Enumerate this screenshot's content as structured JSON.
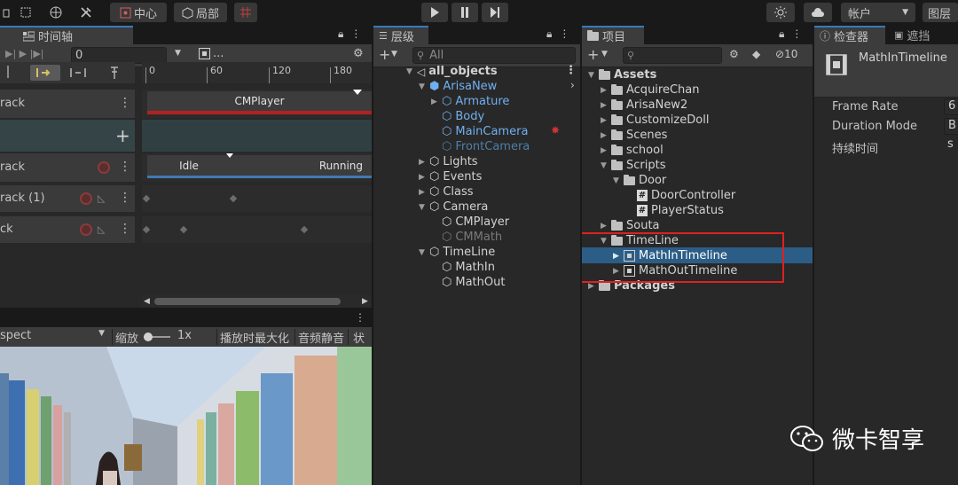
{
  "toolbar": {
    "pivot_label": "中心",
    "space_label": "局部",
    "account_label": "帐户",
    "layers_label": "图层"
  },
  "timeline": {
    "tab_label": "时间轴",
    "frame_value": "0",
    "asset_label": "...",
    "ruler_ticks": [
      "0",
      "60",
      "120",
      "180"
    ],
    "tracks": [
      {
        "label": "rack",
        "clips": [
          {
            "label": "CMPlayer"
          }
        ]
      },
      {
        "label": "rack",
        "clips": [
          {
            "label": "Idle"
          },
          {
            "label": "Running"
          }
        ]
      },
      {
        "label": "rack (1)"
      },
      {
        "label": "ck"
      }
    ]
  },
  "game_view": {
    "aspect_label": "spect",
    "scale_label": "缩放",
    "scale_value": "1x",
    "maximize_label": "播放时最大化",
    "mute_label": "音频静音",
    "stats_label": "状态"
  },
  "hierarchy": {
    "tab_label": "层级",
    "search_placeholder": "All",
    "scene": "all_objects",
    "items": [
      {
        "label": "ArisaNew"
      },
      {
        "label": "Armature"
      },
      {
        "label": "Body"
      },
      {
        "label": "MainCamera"
      },
      {
        "label": "FrontCamera"
      },
      {
        "label": "Lights"
      },
      {
        "label": "Events"
      },
      {
        "label": "Class"
      },
      {
        "label": "Camera"
      },
      {
        "label": "CMPlayer"
      },
      {
        "label": "CMMath"
      },
      {
        "label": "TimeLine"
      },
      {
        "label": "MathIn"
      },
      {
        "label": "MathOut"
      }
    ]
  },
  "project": {
    "tab_label": "项目",
    "hidden_count": "10",
    "items": [
      {
        "label": "Assets"
      },
      {
        "label": "AcquireChan"
      },
      {
        "label": "ArisaNew2"
      },
      {
        "label": "CustomizeDoll"
      },
      {
        "label": "Scenes"
      },
      {
        "label": "school"
      },
      {
        "label": "Scripts"
      },
      {
        "label": "Door"
      },
      {
        "label": "DoorController"
      },
      {
        "label": "PlayerStatus"
      },
      {
        "label": "Souta"
      },
      {
        "label": "TimeLine"
      },
      {
        "label": "MathInTimeline"
      },
      {
        "label": "MathOutTimeline"
      },
      {
        "label": "Packages"
      }
    ]
  },
  "inspector": {
    "tab_label": "检查器",
    "tab2_label": "遮挡",
    "asset_name": "MathInTimeline",
    "fields": [
      {
        "label": "Frame Rate",
        "value": "6"
      },
      {
        "label": "Duration Mode",
        "value": "B"
      },
      {
        "label": "持续时间",
        "value": "s"
      }
    ]
  },
  "watermark": "微卡智享",
  "colors": {
    "accent_blue": "#3a79bb",
    "selection": "#2c5d87",
    "highlight_box": "#e02020",
    "recorded_clip": "#b22222"
  }
}
